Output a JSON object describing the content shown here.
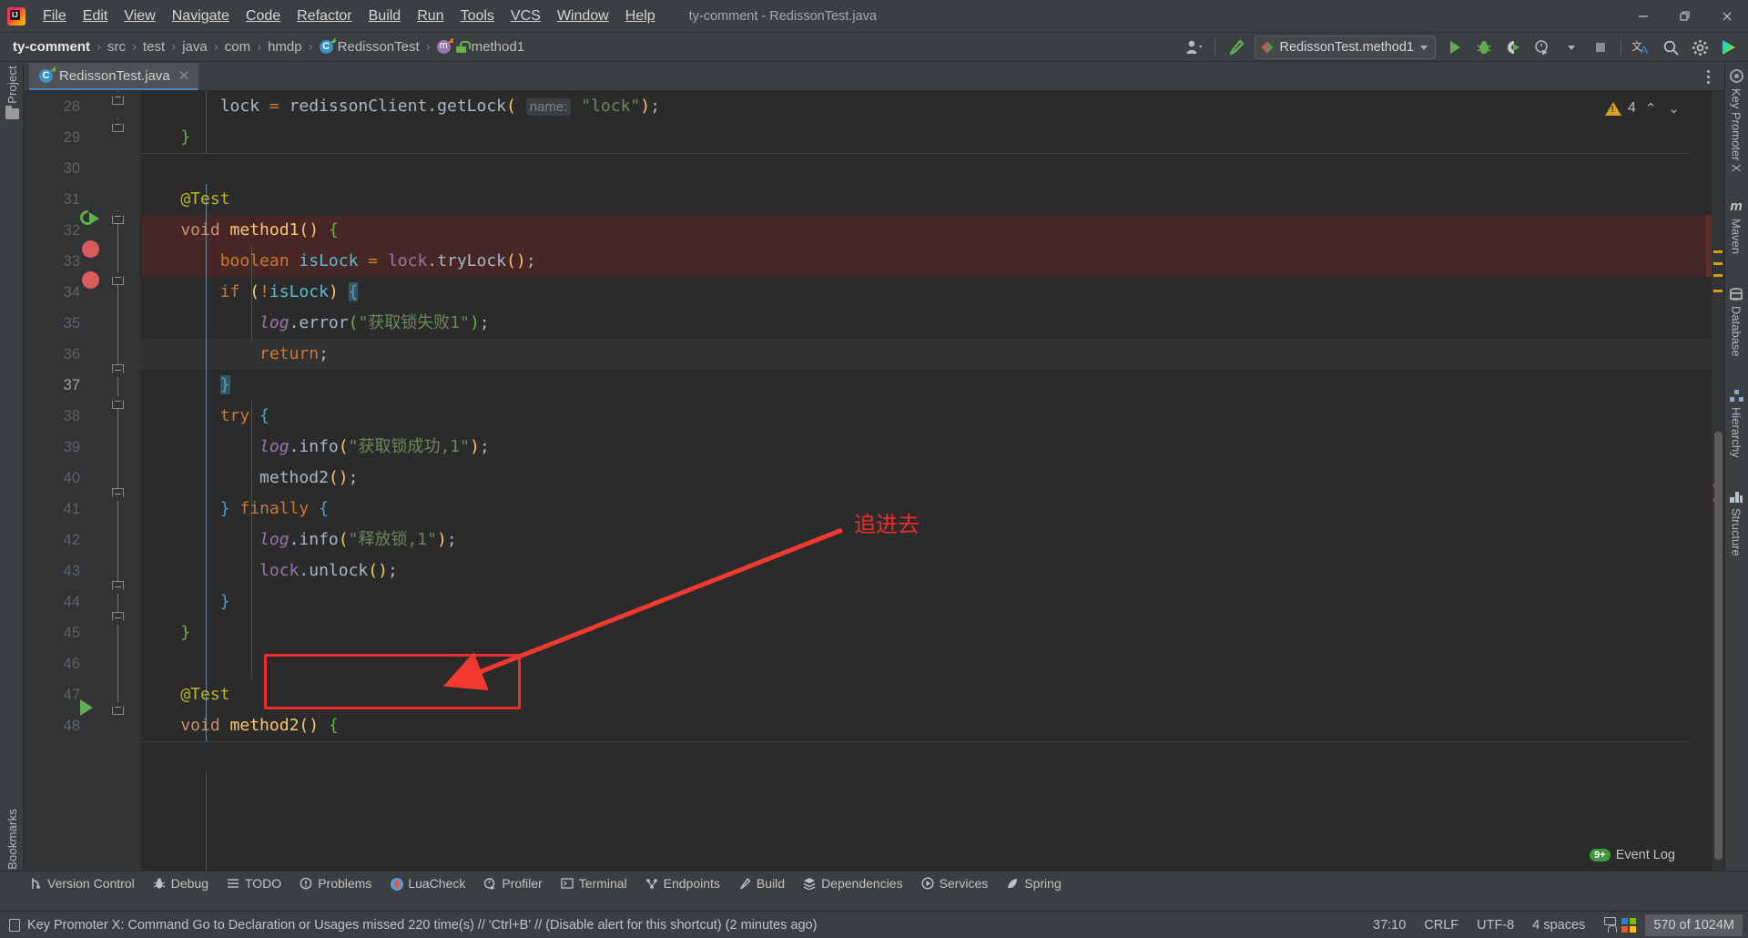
{
  "window": {
    "title": "ty-comment - RedissonTest.java",
    "minimize_label": "—",
    "maximize_label": "❐",
    "close_label": "✕"
  },
  "menubar": {
    "items": [
      {
        "label": "File"
      },
      {
        "label": "Edit"
      },
      {
        "label": "View"
      },
      {
        "label": "Navigate"
      },
      {
        "label": "Code"
      },
      {
        "label": "Refactor"
      },
      {
        "label": "Build"
      },
      {
        "label": "Run"
      },
      {
        "label": "Tools"
      },
      {
        "label": "VCS"
      },
      {
        "label": "Window"
      },
      {
        "label": "Help"
      }
    ]
  },
  "breadcrumb": {
    "items": [
      "ty-comment",
      "src",
      "test",
      "java",
      "com",
      "hmdp",
      "RedissonTest",
      "method1"
    ],
    "separator": "›"
  },
  "toolbar": {
    "run_config_label": "RedissonTest.method1",
    "run_label": "Run",
    "debug_label": "Debug",
    "coverage_label": "Run with Coverage",
    "profiler_label": "Profile",
    "stop_label": "Stop",
    "translate_label": "Translate",
    "search_label": "Search Everywhere",
    "settings_label": "Settings",
    "updates_label": "IDE and Project Updates"
  },
  "tabs": [
    {
      "label": "RedissonTest.java",
      "close": "✕",
      "active": true
    }
  ],
  "left_stripe": [
    {
      "label": "Project",
      "icon": "folder-icon"
    },
    {
      "label": "Bookmarks",
      "icon": "bookmark-icon"
    }
  ],
  "right_stripe": [
    {
      "label": "Key Promoter X",
      "icon": "key-promoter-icon"
    },
    {
      "label": "Maven",
      "icon": "maven-icon"
    },
    {
      "label": "Database",
      "icon": "database-icon"
    },
    {
      "label": "Hierarchy",
      "icon": "hierarchy-icon"
    },
    {
      "label": "Structure",
      "icon": "structure-icon"
    }
  ],
  "inspections": {
    "warning_count": "4",
    "prev_label": "⌃",
    "next_label": "⌄"
  },
  "code": {
    "lines": [
      {
        "n": "28",
        "text": "        lock = redissonClient.getLock( name: \"lock\");"
      },
      {
        "n": "29",
        "text": "    }"
      },
      {
        "n": "30",
        "text": ""
      },
      {
        "n": "31",
        "text": "    @Test"
      },
      {
        "n": "32",
        "text": "    void method1() {"
      },
      {
        "n": "33",
        "text": "        boolean isLock = lock.tryLock();"
      },
      {
        "n": "34",
        "text": "        if (!isLock) {"
      },
      {
        "n": "35",
        "text": "            log.error(\"获取锁失败1\");"
      },
      {
        "n": "36",
        "text": "            return;"
      },
      {
        "n": "37",
        "text": "        }"
      },
      {
        "n": "38",
        "text": "        try {"
      },
      {
        "n": "39",
        "text": "            log.info(\"获取锁成功,1\");"
      },
      {
        "n": "40",
        "text": "            method2();"
      },
      {
        "n": "41",
        "text": "        } finally {"
      },
      {
        "n": "42",
        "text": "            log.info(\"释放锁,1\");"
      },
      {
        "n": "43",
        "text": "            lock.unlock();"
      },
      {
        "n": "44",
        "text": "        }"
      },
      {
        "n": "45",
        "text": "    }"
      },
      {
        "n": "46",
        "text": ""
      },
      {
        "n": "47",
        "text": "    @Test"
      },
      {
        "n": "48",
        "text": "    void method2() {"
      }
    ],
    "param_hint": "name:",
    "current_line": "37"
  },
  "annotations": {
    "callout_text": "追进去",
    "callout_color": "#ee2b2b",
    "box_color": "#ef2d2d"
  },
  "bottom_stripe": [
    {
      "label": "Version Control",
      "icon": "branch-icon"
    },
    {
      "label": "Debug",
      "icon": "bug-icon"
    },
    {
      "label": "TODO",
      "icon": "list-icon"
    },
    {
      "label": "Problems",
      "icon": "warning-circle-icon"
    },
    {
      "label": "LuaCheck",
      "icon": "luacheck-icon"
    },
    {
      "label": "Profiler",
      "icon": "profiler-icon"
    },
    {
      "label": "Terminal",
      "icon": "terminal-icon"
    },
    {
      "label": "Endpoints",
      "icon": "endpoints-icon"
    },
    {
      "label": "Build",
      "icon": "hammer-icon"
    },
    {
      "label": "Dependencies",
      "icon": "dependencies-icon"
    },
    {
      "label": "Services",
      "icon": "services-icon"
    },
    {
      "label": "Spring",
      "icon": "spring-leaf-icon"
    }
  ],
  "statusbar": {
    "message": "Key Promoter X: Command Go to Declaration or Usages missed 220 time(s) // 'Ctrl+B' // (Disable alert for this shortcut) (2 minutes ago)",
    "caret_position": "37:10",
    "line_separator": "CRLF",
    "encoding": "UTF-8",
    "indent": "4 spaces",
    "memory": "570 of 1024M",
    "event_log_label": "Event Log",
    "event_log_badge": "9+"
  },
  "colors": {
    "accent_blue": "#4a88c7",
    "warning_yellow": "#d9a122",
    "breakpoint_red": "#db5c5c",
    "annotation_red": "#ef2d2d",
    "run_green": "#5fad4e",
    "editor_bg": "#2b2b2b",
    "chrome_bg": "#3c3f41"
  }
}
